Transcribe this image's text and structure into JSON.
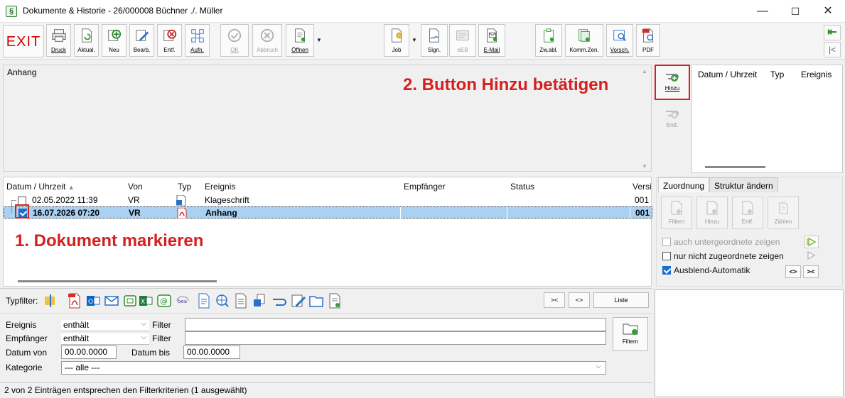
{
  "window": {
    "title": "Dokumente & Historie - 26/000008 Büchner ./. Müller",
    "app_icon": "§",
    "minimize": "—",
    "maximize": "☐",
    "close": "✕"
  },
  "toolbar": {
    "exit": "EXIT",
    "buttons": [
      {
        "label": "Druck",
        "icon": "printer-icon"
      },
      {
        "label": "Aktual.",
        "icon": "refresh-doc-icon"
      },
      {
        "label": "Neu",
        "icon": "new-icon"
      },
      {
        "label": "Bearb.",
        "icon": "edit-icon"
      },
      {
        "label": "Entf.",
        "icon": "delete-icon"
      },
      {
        "label": "Aufn.",
        "icon": "record-icon"
      },
      {
        "label": "OK",
        "icon": "ok-icon"
      },
      {
        "label": "Abbruch",
        "icon": "cancel-icon"
      },
      {
        "label": "Öffnen",
        "icon": "open-icon"
      },
      {
        "label": "Job",
        "icon": "job-icon"
      },
      {
        "label": "Sign.",
        "icon": "sign-icon"
      },
      {
        "label": "eEB",
        "icon": "eeb-icon"
      },
      {
        "label": "E-Mail",
        "icon": "email-icon"
      },
      {
        "label": "Zw.abl.",
        "icon": "clipboard-icon"
      },
      {
        "label": "Komm.Zen.",
        "icon": "comm-center-icon"
      },
      {
        "label": "Vorsch.",
        "icon": "preview-icon"
      },
      {
        "label": "PDF",
        "icon": "pdf-icon"
      }
    ],
    "nav_first": "⇤",
    "nav_prev": "|<"
  },
  "attachment_panel": {
    "label": "Anhang",
    "hint_button": "2. Button Hinzu betätigen"
  },
  "side_buttons": {
    "hinzu": "Hinzu",
    "entf": "Entf."
  },
  "side_table": {
    "headers": [
      "Datum / Uhrzeit",
      "Typ",
      "Ereignis"
    ]
  },
  "grid": {
    "headers": [
      "Datum / Uhrzeit",
      "Von",
      "Typ",
      "Ereignis",
      "Empfänger",
      "Status",
      "Versi"
    ],
    "sort_indicator": "▲",
    "rows": [
      {
        "datetime": "02.05.2022  11:39",
        "von": "VR",
        "typ": "doc",
        "ereignis": "Klageschrift",
        "empfaenger": "",
        "status": "",
        "version": "001",
        "checked": false,
        "selected": false
      },
      {
        "datetime": "16.07.2026  07:20",
        "von": "VR",
        "typ": "pdf",
        "ereignis": "Anhang",
        "empfaenger": "",
        "status": "",
        "version": "001",
        "checked": true,
        "selected": true
      }
    ],
    "hint_mark": "1. Dokument markieren"
  },
  "right_panel": {
    "tabs": [
      "Zuordnung",
      "Struktur ändern"
    ],
    "buttons": [
      "Filtern",
      "Hinzu",
      "Entf.",
      "Zählen"
    ],
    "options": [
      {
        "label": "auch untergeordnete zeigen",
        "checked": false,
        "enabled": false
      },
      {
        "label": "nur nicht zugeordnete zeigen",
        "checked": false,
        "enabled": true
      },
      {
        "label": "Ausblend-Automatik",
        "checked": true,
        "enabled": true
      }
    ],
    "collapse": "<>",
    "expand": "><"
  },
  "filter": {
    "typfilter_label": "Typfilter:",
    "btn_collapse": "><",
    "btn_expand": "<>",
    "btn_list": "Liste",
    "ereignis_label": "Ereignis",
    "ereignis_op": "enthält",
    "empfaenger_label": "Empfänger",
    "empfaenger_op": "enthält",
    "filter_word": "Filter",
    "datum_von_label": "Datum von",
    "datum_von": "00.00.0000",
    "datum_bis_label": "Datum bis",
    "datum_bis": "00.00.0000",
    "kategorie_label": "Kategorie",
    "kategorie": "--- alle ---",
    "filter_button": "Filtern"
  },
  "status": {
    "text": "2 von 2 Einträgen entsprechen den Filterkriterien (1 ausgewählt)"
  },
  "colors": {
    "annotation_red": "#d42020",
    "selection_blue": "#aad0f2",
    "check_blue": "#1a6fcc"
  }
}
